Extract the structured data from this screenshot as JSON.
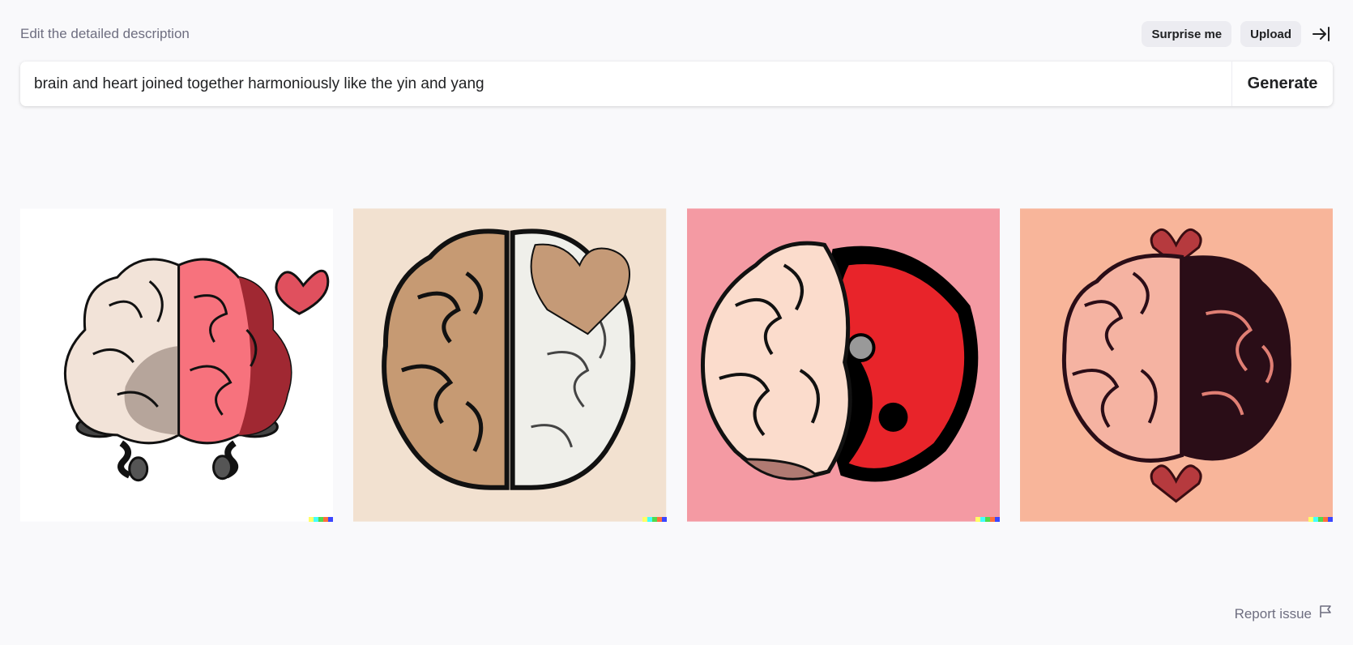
{
  "header": {
    "hint": "Edit the detailed description",
    "surprise_label": "Surprise me",
    "upload_label": "Upload"
  },
  "prompt": {
    "value": "brain and heart joined together harmoniously like the yin and yang",
    "generate_label": "Generate"
  },
  "gallery": {
    "images": [
      {
        "background": "#ffffff",
        "subject": "cartoon brain half beige half pink with heart"
      },
      {
        "background": "#f2e1d0",
        "subject": "brown and white brain halves with tan heart"
      },
      {
        "background": "#f49aa3",
        "subject": "brain with red yin yang shape"
      },
      {
        "background": "#f8b59a",
        "subject": "pink and dark brain halves with two hearts"
      }
    ],
    "signature_colors": [
      "#ffff66",
      "#42ffff",
      "#51da4c",
      "#ff6e3c",
      "#3c46ff"
    ]
  },
  "footer": {
    "report_label": "Report issue"
  },
  "colors": {
    "page_background": "#f9f9fb",
    "pill_background": "#ececf1",
    "muted_text": "#6e6e80"
  },
  "icons": [
    "collapse-panel-icon",
    "flag-icon"
  ]
}
